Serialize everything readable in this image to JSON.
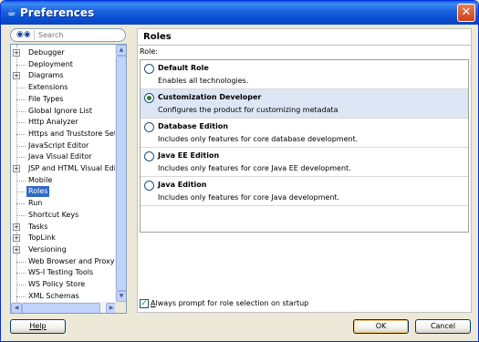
{
  "window": {
    "title": "Preferences",
    "close_glyph": "✕"
  },
  "search": {
    "placeholder": "Search"
  },
  "tree": {
    "items": [
      {
        "label": "Debugger",
        "expandable": true
      },
      {
        "label": "Deployment",
        "expandable": false
      },
      {
        "label": "Diagrams",
        "expandable": true
      },
      {
        "label": "Extensions",
        "expandable": false
      },
      {
        "label": "File Types",
        "expandable": false
      },
      {
        "label": "Global Ignore List",
        "expandable": false
      },
      {
        "label": "Http Analyzer",
        "expandable": false
      },
      {
        "label": "Https and Truststore Settin",
        "expandable": false
      },
      {
        "label": "JavaScript Editor",
        "expandable": false
      },
      {
        "label": "Java Visual Editor",
        "expandable": false
      },
      {
        "label": "JSP and HTML Visual Editor",
        "expandable": true
      },
      {
        "label": "Mobile",
        "expandable": false
      },
      {
        "label": "Roles",
        "expandable": false,
        "selected": true
      },
      {
        "label": "Run",
        "expandable": false
      },
      {
        "label": "Shortcut Keys",
        "expandable": false
      },
      {
        "label": "Tasks",
        "expandable": true
      },
      {
        "label": "TopLink",
        "expandable": true
      },
      {
        "label": "Versioning",
        "expandable": true
      },
      {
        "label": "Web Browser and Proxy",
        "expandable": false
      },
      {
        "label": "WS-I Testing Tools",
        "expandable": false
      },
      {
        "label": "WS Policy Store",
        "expandable": false
      },
      {
        "label": "XML Schemas",
        "expandable": false
      }
    ]
  },
  "roles_page": {
    "title": "Roles",
    "role_label": "Role:",
    "options": [
      {
        "name": "Default Role",
        "description": "Enables all technologies.",
        "selected": false
      },
      {
        "name": "Customization Developer",
        "description": "Configures the product for customizing metadata",
        "selected": true
      },
      {
        "name": "Database Edition",
        "description": "Includes only features for core database development.",
        "selected": false
      },
      {
        "name": "Java EE Edition",
        "description": "Includes only features for core Java EE development.",
        "selected": false
      },
      {
        "name": "Java Edition",
        "description": "Includes only features for core Java development.",
        "selected": false
      }
    ],
    "always_prompt": {
      "label_mnemonic": "A",
      "label_rest": "lways prompt for role selection on startup",
      "checked": true
    }
  },
  "buttons": {
    "help": "Help",
    "ok": "OK",
    "cancel": "Cancel"
  },
  "colors": {
    "titlebar": "#0a4ed1",
    "selection": "#316ac5",
    "dialog_bg": "#ece9d8"
  }
}
